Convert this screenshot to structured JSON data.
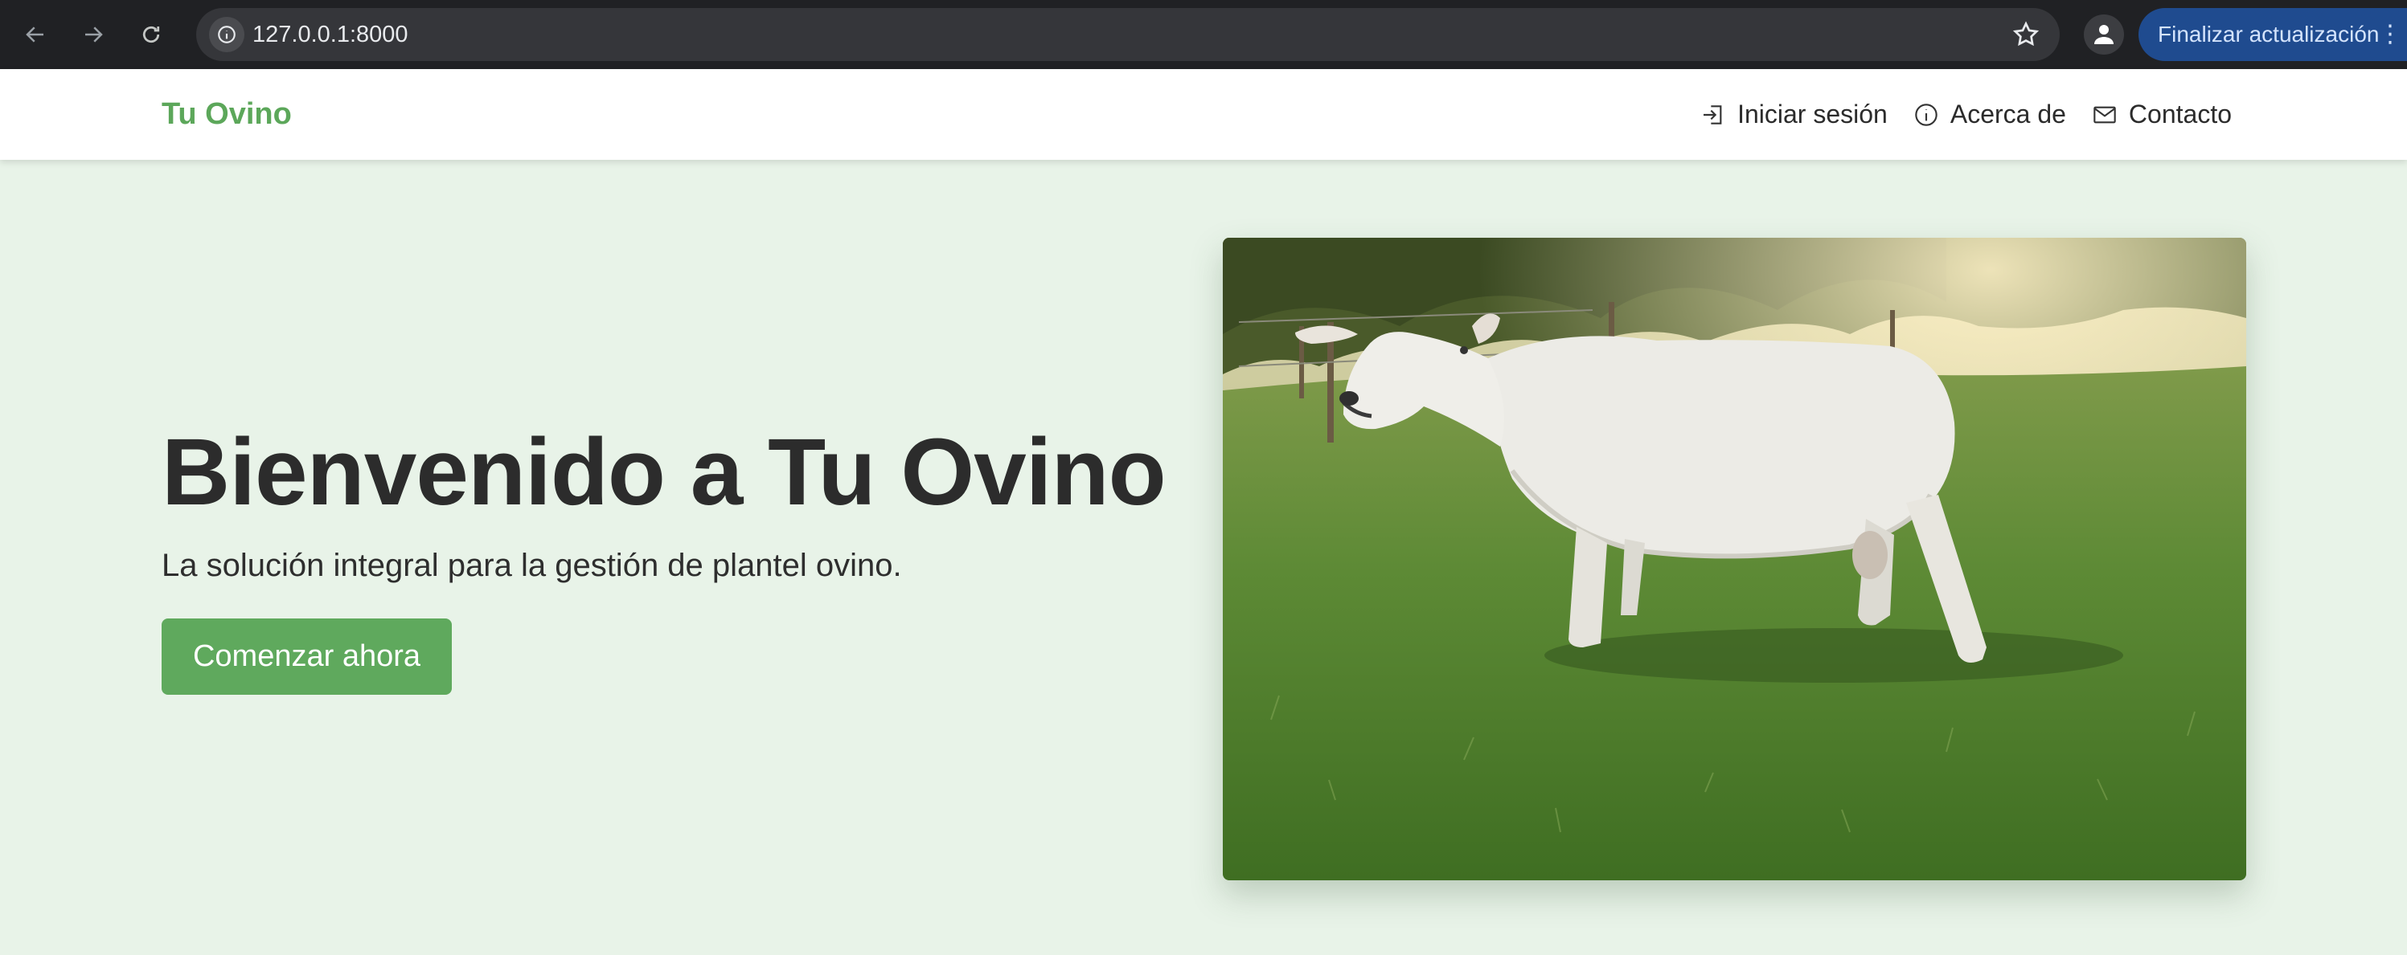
{
  "browser": {
    "url": "127.0.0.1:8000",
    "update_button": "Finalizar actualización"
  },
  "navbar": {
    "brand": "Tu Ovino",
    "links": [
      {
        "label": "Iniciar sesión",
        "icon": "login-icon"
      },
      {
        "label": "Acerca de",
        "icon": "info-icon"
      },
      {
        "label": "Contacto",
        "icon": "envelope-icon"
      }
    ]
  },
  "hero": {
    "title": "Bienvenido a Tu Ovino",
    "subtitle": "La solución integral para la gestión de plantel ovino.",
    "cta": "Comenzar ahora",
    "image": "sheep-photo"
  },
  "colors": {
    "brand": "#5ca75a",
    "background": "#e8f3e8",
    "cta": "#5fa95d"
  }
}
